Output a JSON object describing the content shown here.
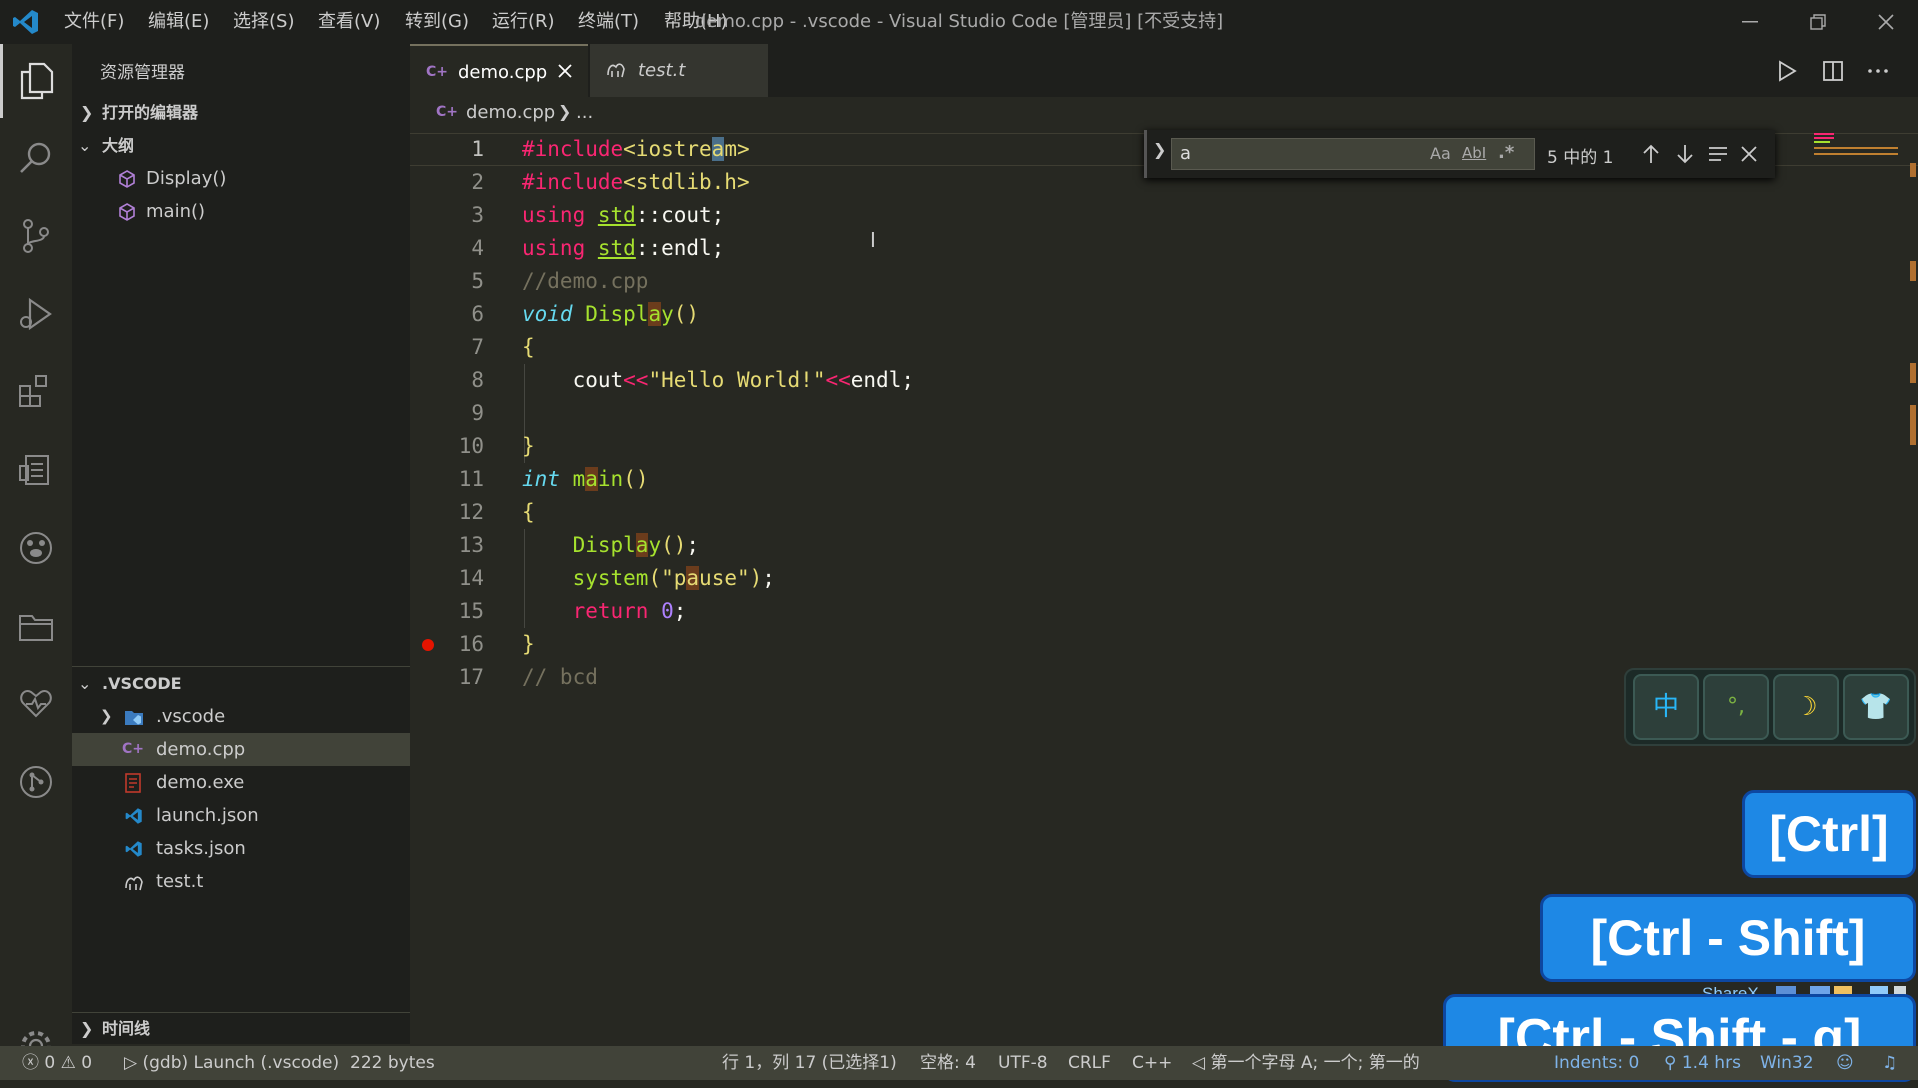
{
  "titlebar": {
    "menus": [
      "文件(F)",
      "编辑(E)",
      "选择(S)",
      "查看(V)",
      "转到(G)",
      "运行(R)",
      "终端(T)",
      "帮助(H)"
    ],
    "title": "demo.cpp - .vscode - Visual Studio Code [管理员] [不受支持]"
  },
  "sidebar": {
    "title": "资源管理器",
    "open_editors": "打开的编辑器",
    "outline": "大纲",
    "outline_items": [
      "Display()",
      "main()"
    ],
    "workspace": ".VSCODE",
    "files": [
      ".vscode",
      "demo.cpp",
      "demo.exe",
      "launch.json",
      "tasks.json",
      "test.t"
    ],
    "timeline": "时间线"
  },
  "tabs": [
    {
      "label": "demo.cpp",
      "active": true
    },
    {
      "label": "test.t",
      "active": false
    }
  ],
  "breadcrumb": {
    "file": "demo.cpp",
    "rest": "..."
  },
  "find": {
    "query": "a",
    "result": "5 中的 1",
    "case_label": "Aa",
    "word_label": "AbI",
    "regex_label": ".*"
  },
  "code": {
    "line_numbers": [
      "1",
      "2",
      "3",
      "4",
      "5",
      "6",
      "7",
      "8",
      "9",
      "10",
      "11",
      "12",
      "13",
      "14",
      "15",
      "16",
      "17"
    ],
    "breakpoint_line": 16,
    "lines": [
      "#include<iostream>",
      "#include<stdlib.h>",
      "using std::cout;",
      "using std::endl;",
      "//demo.cpp",
      "void Display()",
      "{",
      "    cout<<\"Hello World!\"<<endl;",
      "",
      "}",
      "int main()",
      "{",
      "    Display();",
      "    system(\"pause\");",
      "    return 0;",
      "}",
      "// bcd"
    ]
  },
  "statusbar": {
    "errors": "0",
    "warnings": "0",
    "launch": "(gdb) Launch (.vscode)",
    "size": "222 bytes",
    "position": "行 1，列 17 (已选择1)",
    "spaces": "空格: 4",
    "encoding": "UTF-8",
    "eol": "CRLF",
    "language": "C++",
    "message": "第一个字母 A; 一个; 第一的",
    "indents": "Indents: 0",
    "hours": "1.4 hrs",
    "platform": "Win32"
  },
  "ime": {
    "buttons": [
      "中",
      "°,",
      "☽",
      "👕"
    ]
  },
  "sharex": "ShareX",
  "keys": [
    "[Ctrl]",
    "[Ctrl - Shift]",
    "[Ctrl - Shift - g]"
  ],
  "colors": {
    "accent": "#1e88e5",
    "breakpoint": "#e51400"
  }
}
